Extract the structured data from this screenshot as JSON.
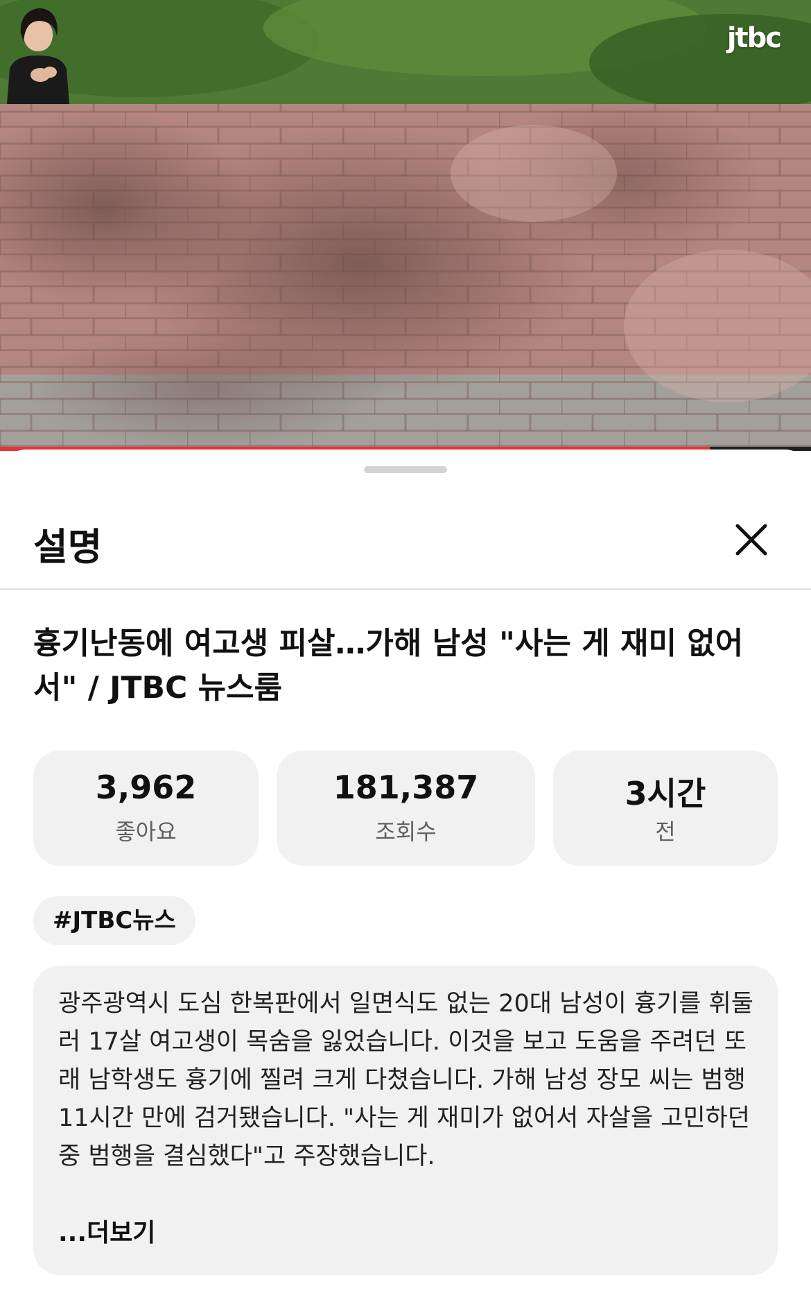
{
  "video": {
    "channel_logo": "jtbc",
    "progress_fraction": 0.875,
    "colors": {
      "progress": "#e8333c"
    }
  },
  "sheet": {
    "title": "설명",
    "close_icon": "close-icon"
  },
  "video_title": "흉기난동에 여고생 피살…가해 남성 \"사는 게 재미 없어서\" / JTBC 뉴스룸",
  "stats": [
    {
      "value": "3,962",
      "label": "좋아요"
    },
    {
      "value": "181,387",
      "label": "조회수"
    },
    {
      "value": "3시간",
      "label": "전"
    }
  ],
  "hashtag": "#JTBC뉴스",
  "description": {
    "text": "광주광역시 도심 한복판에서 일면식도 없는 20대 남성이 흉기를 휘둘러 17살 여고생이 목숨을 잃었습니다. 이것을 보고 도움을 주려던 또래 남학생도 흉기에 찔려 크게 다쳤습니다. 가해 남성 장모 씨는 범행 11시간 만에 검거됐습니다. \"사는 게 재미가 없어서 자살을 고민하던 중 범행을 결심했다\"고 주장했습니다.",
    "more_label": "...더보기"
  }
}
